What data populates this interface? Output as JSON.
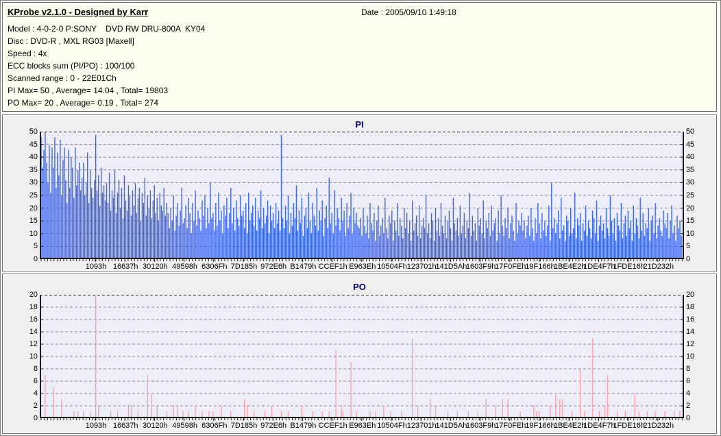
{
  "header": {
    "app_title": "KProbe v2.1.0 - Designed by Karr",
    "date_label": "Date : 2005/09/10 1:49:18",
    "info_lines": [
      "Model : 4-0-2-0 P:SONY    DVD RW DRU-800A  KY04",
      "Disc : DVD-R , MXL RG03 [Maxell]",
      "Speed : 4x",
      "ECC blocks sum (PI/PO) : 100/100",
      "Scanned range : 0 - 22E01Ch",
      "PI Max= 50 , Average= 14.04 , Total= 19803",
      "PO Max= 20 , Average= 0.19 , Total= 274"
    ]
  },
  "colors": {
    "window_bg": "#ffffff",
    "info_bg": "#fdfdf0",
    "panel_bg": "#f0f0f0",
    "plot_bg": "#eeeefa",
    "grid": "#8a8a8a",
    "axis": "#1a1a1a",
    "title_text": "#000080",
    "pi_bar": "#3a66f5",
    "po_bar": "#f5a6a6"
  },
  "x_labels": [
    "1093h",
    "16637h",
    "30120h",
    "49598h",
    "6306Fh",
    "7D185h",
    "972E6h",
    "B1479h",
    "CCEF1h",
    "E963Eh",
    "10504Fh",
    "123701h",
    "141D5Ah",
    "1603F9h",
    "17F0FEh",
    "19F166h",
    "1BE4E2h",
    "1DE4F7h",
    "1FDE16h",
    "21D232h"
  ],
  "chart_data": [
    {
      "type": "bar",
      "title": "PI",
      "ylabel": "",
      "ylim": [
        0,
        50
      ],
      "ytick_step": 5,
      "grid": "horizontal-dashed",
      "legend": "none",
      "bar_color": "#3a66f5",
      "stats": {
        "max": 50,
        "average": 14.04,
        "total": 19803
      },
      "values": [
        48,
        36,
        43,
        50,
        38,
        30,
        45,
        26,
        44,
        36,
        48,
        28,
        42,
        33,
        47,
        25,
        39,
        44,
        31,
        22,
        43,
        28,
        40,
        36,
        24,
        44,
        29,
        35,
        38,
        27,
        32,
        38,
        25,
        30,
        42,
        22,
        35,
        28,
        24,
        31,
        49,
        27,
        33,
        21,
        36,
        26,
        29,
        23,
        30,
        22,
        34,
        19,
        27,
        24,
        35,
        18,
        26,
        31,
        20,
        28,
        16,
        33,
        23,
        19,
        29,
        25,
        17,
        27,
        21,
        30,
        18,
        24,
        28,
        15,
        26,
        22,
        32,
        17,
        25,
        20,
        27,
        16,
        23,
        29,
        18,
        24,
        15,
        26,
        21,
        19,
        28,
        17,
        22,
        18,
        12,
        20,
        15,
        25,
        11,
        17,
        22,
        13,
        19,
        28,
        14,
        16,
        21,
        12,
        24,
        18,
        10,
        22,
        15,
        27,
        13,
        19,
        16,
        11,
        23,
        17,
        25,
        12,
        20,
        14,
        30,
        16,
        18,
        11,
        22,
        13,
        26,
        15,
        19,
        10,
        21,
        17,
        24,
        12,
        18,
        28,
        14,
        20,
        11,
        23,
        16,
        13,
        25,
        17,
        19,
        12,
        22,
        10,
        26,
        15,
        18,
        21,
        13,
        24,
        11,
        19,
        16,
        27,
        12,
        20,
        14,
        17,
        23,
        10,
        21,
        15,
        18,
        12,
        22,
        14,
        19,
        11,
        49,
        16,
        12,
        21,
        15,
        25,
        10,
        18,
        13,
        22,
        16,
        29,
        11,
        19,
        14,
        24,
        9,
        17,
        20,
        12,
        26,
        15,
        10,
        22,
        17,
        13,
        28,
        11,
        19,
        15,
        23,
        9,
        16,
        21,
        12,
        32,
        14,
        18,
        10,
        27,
        13,
        20,
        16,
        11,
        24,
        15,
        19,
        9,
        22,
        12,
        17,
        26,
        10,
        20,
        14,
        18,
        13,
        12,
        16,
        9,
        20,
        13,
        10,
        17,
        8,
        22,
        14,
        11,
        18,
        7,
        15,
        21,
        9,
        13,
        16,
        10,
        24,
        12,
        8,
        17,
        14,
        19,
        7,
        15,
        11,
        22,
        9,
        16,
        13,
        8,
        20,
        12,
        18,
        10,
        15,
        7,
        23,
        11,
        14,
        17,
        9,
        21,
        8,
        13,
        16,
        12,
        25,
        10,
        14,
        8,
        18,
        15,
        7,
        20,
        11,
        16,
        9,
        22,
        13,
        10,
        17,
        8,
        15,
        19,
        12,
        7,
        24,
        14,
        11,
        16,
        9,
        21,
        10,
        13,
        18,
        8,
        15,
        12,
        26,
        9,
        17,
        11,
        14,
        7,
        20,
        13,
        16,
        10,
        23,
        8,
        15,
        12,
        18,
        9,
        21,
        11,
        14,
        16,
        7,
        19,
        10,
        25,
        13,
        9,
        16,
        12,
        20,
        8,
        14,
        17,
        11,
        7,
        22,
        10,
        15,
        13,
        18,
        11,
        15,
        8,
        13,
        17,
        9,
        20,
        12,
        7,
        16,
        10,
        22,
        14,
        8,
        18,
        11,
        15,
        9,
        13,
        21,
        7,
        30,
        12,
        16,
        10,
        14,
        19,
        8,
        24,
        11,
        13,
        7,
        17,
        15,
        9,
        20,
        10,
        12,
        26,
        8,
        16,
        13,
        18,
        7,
        14,
        11,
        21,
        9,
        15,
        12,
        8,
        19,
        16,
        10,
        23,
        7,
        13,
        17,
        11,
        14,
        8,
        20,
        12,
        9,
        25,
        15,
        10,
        16,
        7,
        18,
        13,
        11,
        22,
        8,
        14,
        17,
        9,
        19,
        12,
        15,
        7,
        21,
        10,
        16,
        13,
        8,
        24,
        11,
        18,
        9,
        14,
        12,
        20,
        7,
        15,
        17,
        10,
        22,
        8,
        13,
        16,
        11,
        9,
        19,
        14,
        12,
        18,
        8,
        15,
        21,
        10,
        13,
        7,
        17,
        12,
        15,
        9
      ]
    },
    {
      "type": "bar",
      "title": "PO",
      "ylabel": "",
      "ylim": [
        0,
        20
      ],
      "ytick_step": 2,
      "grid": "horizontal-dashed",
      "legend": "none",
      "bar_color": "#f5a6a6",
      "stats": {
        "max": 20,
        "average": 0.19,
        "total": 274
      },
      "num_points": 470,
      "sparse_values": [
        [
          3,
          7
        ],
        [
          9,
          5
        ],
        [
          15,
          3
        ],
        [
          24,
          1
        ],
        [
          27,
          1
        ],
        [
          31,
          1
        ],
        [
          36,
          1
        ],
        [
          40,
          20
        ],
        [
          42,
          2
        ],
        [
          51,
          1
        ],
        [
          56,
          1
        ],
        [
          64,
          2
        ],
        [
          66,
          2
        ],
        [
          71,
          1
        ],
        [
          78,
          7
        ],
        [
          81,
          4
        ],
        [
          85,
          2
        ],
        [
          92,
          1
        ],
        [
          97,
          2
        ],
        [
          100,
          2
        ],
        [
          104,
          1
        ],
        [
          108,
          1
        ],
        [
          113,
          2
        ],
        [
          118,
          1
        ],
        [
          123,
          1
        ],
        [
          126,
          1
        ],
        [
          132,
          2
        ],
        [
          139,
          1
        ],
        [
          149,
          3
        ],
        [
          151,
          2
        ],
        [
          156,
          1
        ],
        [
          164,
          1
        ],
        [
          169,
          2
        ],
        [
          176,
          1
        ],
        [
          181,
          1
        ],
        [
          191,
          2
        ],
        [
          199,
          1
        ],
        [
          206,
          1
        ],
        [
          211,
          1
        ],
        [
          216,
          11
        ],
        [
          220,
          2
        ],
        [
          221,
          1
        ],
        [
          227,
          9
        ],
        [
          231,
          1
        ],
        [
          241,
          1
        ],
        [
          245,
          1
        ],
        [
          251,
          2
        ],
        [
          256,
          1
        ],
        [
          264,
          1
        ],
        [
          272,
          13
        ],
        [
          276,
          2
        ],
        [
          285,
          3
        ],
        [
          289,
          2
        ],
        [
          298,
          1
        ],
        [
          305,
          1
        ],
        [
          313,
          1
        ],
        [
          320,
          1
        ],
        [
          326,
          3
        ],
        [
          333,
          2
        ],
        [
          338,
          3
        ],
        [
          342,
          3
        ],
        [
          351,
          1
        ],
        [
          361,
          2
        ],
        [
          363,
          1
        ],
        [
          365,
          1
        ],
        [
          373,
          2
        ],
        [
          377,
          4
        ],
        [
          380,
          3
        ],
        [
          382,
          3
        ],
        [
          389,
          1
        ],
        [
          395,
          8
        ],
        [
          398,
          1
        ],
        [
          404,
          13
        ],
        [
          409,
          1
        ],
        [
          413,
          2
        ],
        [
          415,
          7
        ],
        [
          422,
          1
        ],
        [
          428,
          1
        ],
        [
          435,
          4
        ],
        [
          438,
          1
        ],
        [
          444,
          1
        ],
        [
          450,
          1
        ],
        [
          457,
          1
        ],
        [
          464,
          1
        ],
        [
          468,
          1
        ]
      ]
    }
  ]
}
